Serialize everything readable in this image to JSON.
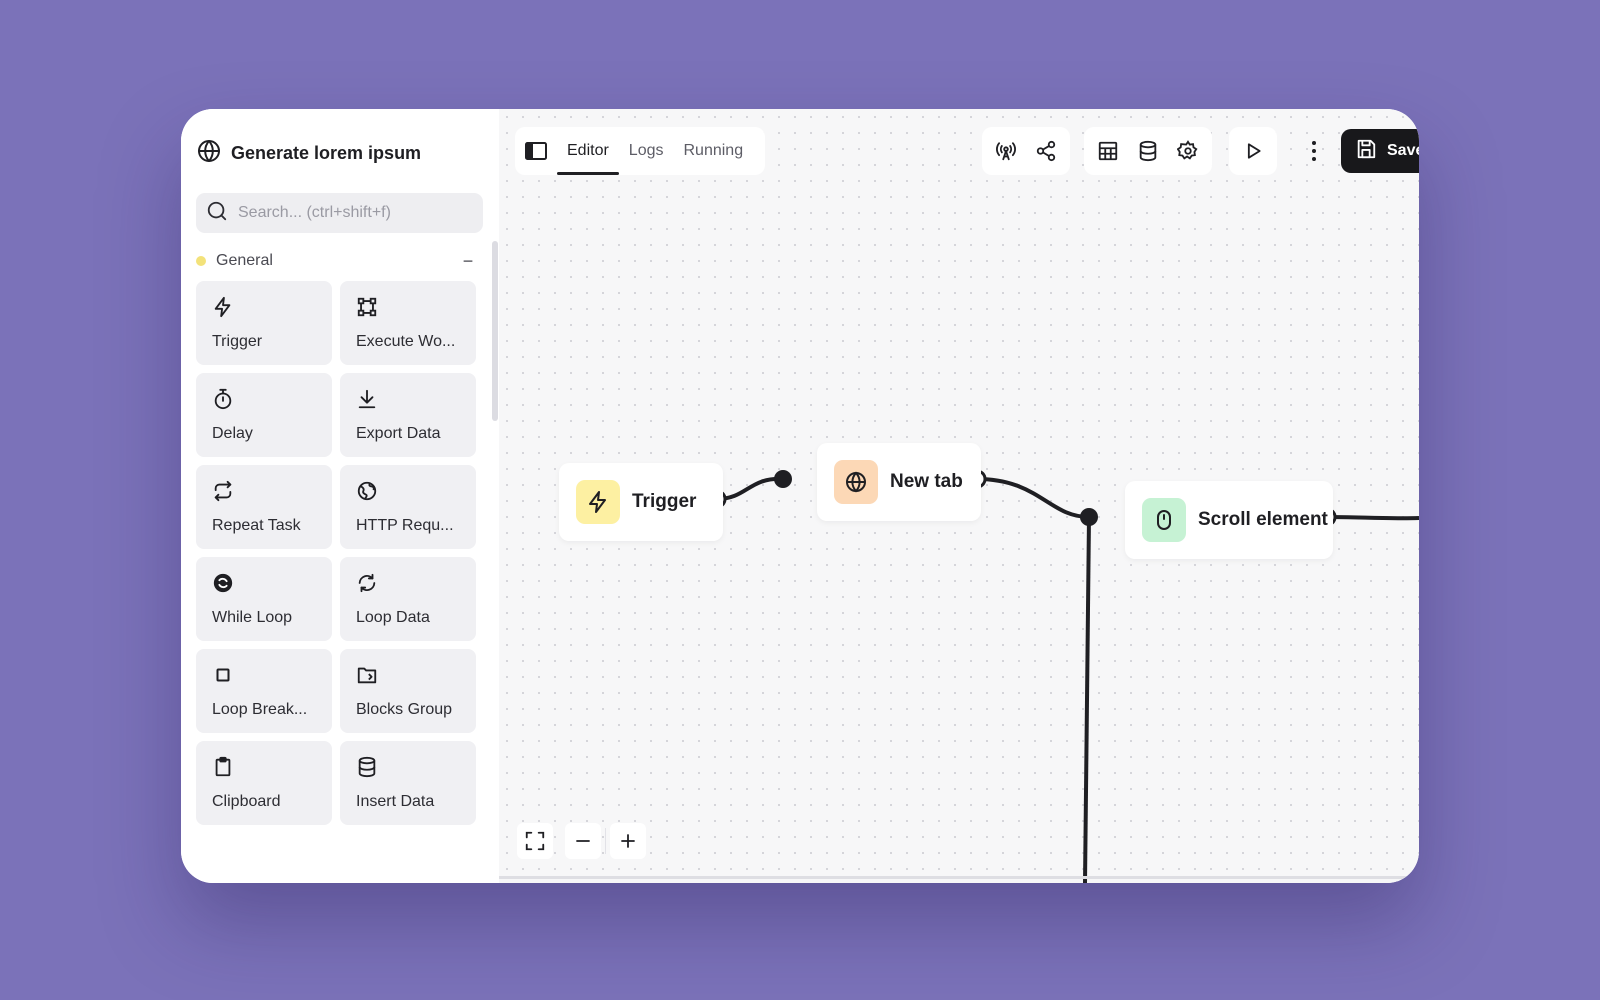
{
  "workflow": {
    "title": "Generate lorem ipsum"
  },
  "search": {
    "placeholder": "Search... (ctrl+shift+f)",
    "value": ""
  },
  "category": {
    "label": "General",
    "dot_color": "#f3e27a",
    "collapse_symbol": "−"
  },
  "blocks": [
    {
      "label": "Trigger",
      "icon": "lightning-icon"
    },
    {
      "label": "Execute Wo...",
      "icon": "workflow-icon"
    },
    {
      "label": "Delay",
      "icon": "timer-icon"
    },
    {
      "label": "Export Data",
      "icon": "download-icon"
    },
    {
      "label": "Repeat Task",
      "icon": "repeat-icon"
    },
    {
      "label": "HTTP Requ...",
      "icon": "globe-icon"
    },
    {
      "label": "While Loop",
      "icon": "loop-circle-icon"
    },
    {
      "label": "Loop Data",
      "icon": "refresh-icon"
    },
    {
      "label": "Loop Break...",
      "icon": "stop-square-icon"
    },
    {
      "label": "Blocks Group",
      "icon": "folder-icon"
    },
    {
      "label": "Clipboard",
      "icon": "clipboard-icon"
    },
    {
      "label": "Insert Data",
      "icon": "database-icon"
    }
  ],
  "tabs": [
    {
      "label": "Editor",
      "active": true
    },
    {
      "label": "Logs",
      "active": false
    },
    {
      "label": "Running",
      "active": false
    }
  ],
  "toolbar": {
    "save_label": "Save",
    "icons": [
      "broadcast-icon",
      "share-icon",
      "table-icon",
      "database-icon",
      "settings-icon",
      "play-icon",
      "more-icon",
      "save-icon"
    ]
  },
  "nodes": [
    {
      "label": "Trigger",
      "icon": "lightning-icon",
      "icon_bg": "#fdf0a2"
    },
    {
      "label": "New tab",
      "icon": "globe-icon",
      "icon_bg": "#fcd8b6"
    },
    {
      "label": "Scroll element",
      "icon": "mouse-icon",
      "icon_bg": "#c6f2d4"
    }
  ],
  "colors": {
    "background": "#7b72b9",
    "accent_dark": "#18181b",
    "canvas": "#f7f7f8"
  }
}
